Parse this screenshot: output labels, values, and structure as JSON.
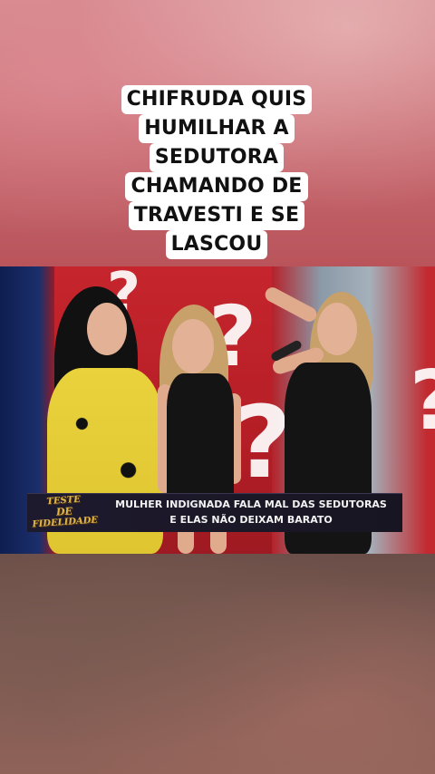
{
  "overlay": {
    "caption_lines": [
      "CHIFRUDA QUIS",
      "HUMILHAR A",
      "SEDUTORA",
      "CHAMANDO DE",
      "TRAVESTI E SE",
      "LASCOU"
    ]
  },
  "video": {
    "show_logo": [
      "TESTE",
      "DE",
      "FIDELIDADE"
    ],
    "lower_third": [
      "MULHER INDIGNADA FALA MAL DAS SEDUTORAS",
      "E ELAS NÃO DEIXAM BARATO"
    ],
    "set_symbol": "?"
  },
  "colors": {
    "caption_bg": "#ffffff",
    "caption_text": "#111111",
    "lower_third_bg": "#1e1a2e",
    "logo_gold": "#e2b74a",
    "set_red": "#c6252d"
  }
}
